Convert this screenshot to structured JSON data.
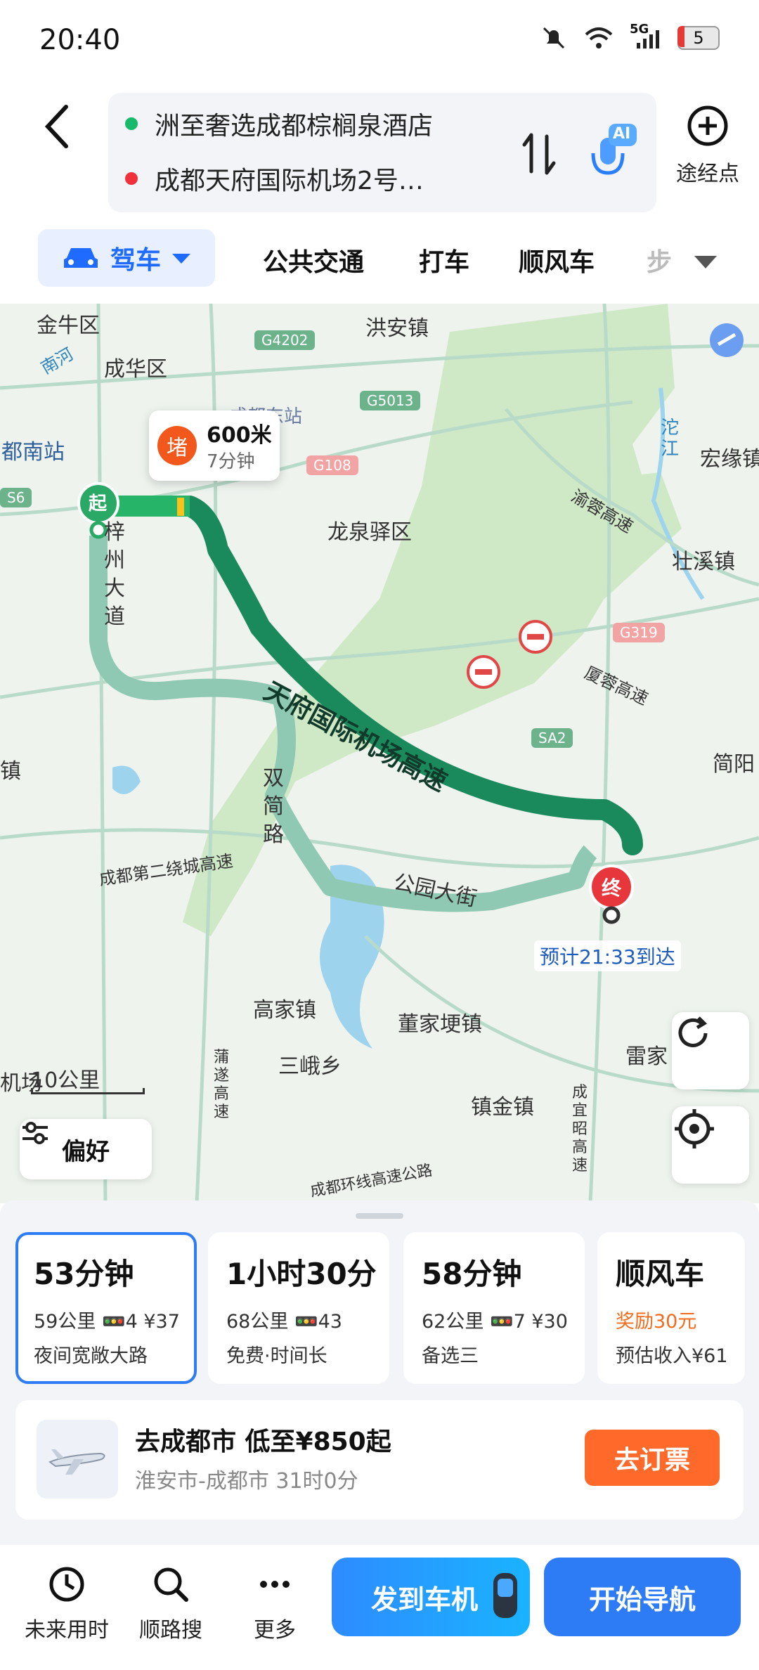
{
  "status": {
    "time": "20:40",
    "network": "5G",
    "battery": "5"
  },
  "header": {
    "origin": "洲至奢选成都棕榈泉酒店",
    "destination": "成都天府国际机场2号…",
    "waypoint_label": "途经点",
    "ai_label": "AI"
  },
  "tabs": {
    "drive": "驾车",
    "transit": "公共交通",
    "taxi": "打车",
    "carpool": "顺风车",
    "walk_partial": "步"
  },
  "map": {
    "labels": {
      "jinniu": "金牛区",
      "nanhe": "南河",
      "chenghua": "成华区",
      "hongan": "洪安镇",
      "chengdu_east": "成都东站",
      "chengdu_south_partial": "都南站",
      "longquanyi": "龙泉驿区",
      "tuojiang": "沱江",
      "hongyuan": "宏缘镇",
      "zhuangxi": "壮溪镇",
      "yurong": "渝蓉高速",
      "xiarong": "厦蓉高速",
      "jianyang": "简阳",
      "zizhou": "梓州大道",
      "airport_expressway": "天府国际机场高速",
      "shuangjian": "双简路",
      "ring2": "成都第二绕城高速",
      "gongyuan": "公园大街",
      "gaojia": "高家镇",
      "dongjiageng": "董家埂镇",
      "sane": "三峨乡",
      "zhenjin": "镇金镇",
      "leijia": "雷家",
      "chengyichao": "成宜昭高速",
      "pusui": "蒲遂高速",
      "ring_highway": "成都环线高速公路",
      "zhen_left": "镇",
      "airport_left": "机场",
      "qidian": "起",
      "zhongdian": "终"
    },
    "road_badges": [
      "G4202",
      "G5013",
      "G108",
      "G319",
      "SA2",
      "S6"
    ],
    "traffic": {
      "icon": "堵",
      "distance": "600米",
      "time": "7分钟"
    },
    "eta": "预计21:33到达",
    "scale": "10公里",
    "prefs_label": "偏好"
  },
  "routes": [
    {
      "time": "53分钟",
      "distance": "59公里",
      "lights": "4",
      "toll": "¥37",
      "note": "夜间宽敞大路",
      "selected": true
    },
    {
      "time": "1小时30分",
      "distance": "68公里",
      "lights": "43",
      "toll": "",
      "note": "免费·时间长",
      "selected": false
    },
    {
      "time": "58分钟",
      "distance": "62公里",
      "lights": "7",
      "toll": "¥30",
      "note": "备选三",
      "selected": false
    },
    {
      "time": "顺风车",
      "reward": "奖励30元",
      "income": "预估收入¥61"
    }
  ],
  "flight": {
    "title": "去成都市 低至¥850起",
    "subtitle": "淮安市-成都市 31时0分",
    "button": "去订票"
  },
  "bottom_nav": {
    "future": "未来用时",
    "along": "顺路搜",
    "more": "更多",
    "send": "发到车机",
    "navigate": "开始导航"
  },
  "colors": {
    "accent": "#2d7cf6",
    "route_main": "#1a8a5c",
    "route_alt": "#8fc9b3",
    "orange": "#ff6a2b"
  }
}
